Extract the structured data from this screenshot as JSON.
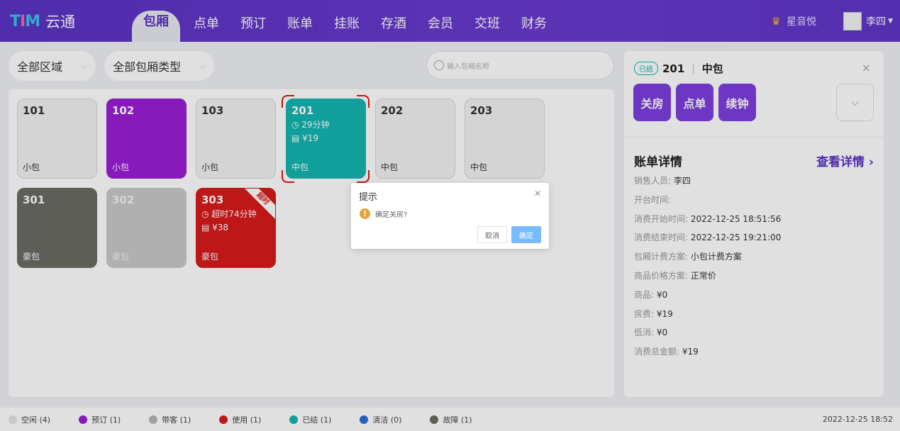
{
  "header": {
    "logo_letters": [
      "T",
      "I",
      "M"
    ],
    "logo_text": "云通",
    "nav": [
      "包厢",
      "点单",
      "预订",
      "账单",
      "挂账",
      "存酒",
      "会员",
      "交班",
      "财务"
    ],
    "active_nav": "包厢",
    "store_name": "星音悦",
    "user_name": "李四"
  },
  "filters": {
    "area": "全部区域",
    "room_type": "全部包厢类型",
    "search_placeholder": "输入包厢名称"
  },
  "rooms": [
    {
      "num": "101",
      "type": "小包",
      "state": "free"
    },
    {
      "num": "102",
      "type": "小包",
      "state": "reserved"
    },
    {
      "num": "103",
      "type": "小包",
      "state": "free"
    },
    {
      "num": "201",
      "type": "中包",
      "state": "settled",
      "duration": "29分钟",
      "amount": "¥19"
    },
    {
      "num": "202",
      "type": "中包",
      "state": "free"
    },
    {
      "num": "203",
      "type": "中包",
      "state": "free"
    },
    {
      "num": "301",
      "type": "豪包",
      "state": "fault"
    },
    {
      "num": "302",
      "type": "豪包",
      "state": "guest"
    },
    {
      "num": "303",
      "type": "豪包",
      "state": "inuse",
      "duration": "超时74分钟",
      "amount": "¥38",
      "ribbon": "超时"
    }
  ],
  "panel": {
    "status_badge": "已结",
    "room_num": "201",
    "room_type": "中包",
    "actions": [
      "关房",
      "点单",
      "续钟"
    ],
    "bill_title": "账单详情",
    "bill_link": "查看详情 ›",
    "bill_rows": [
      {
        "label": "销售人员:",
        "value": "李四"
      },
      {
        "label": "开台时间:",
        "value": ""
      },
      {
        "label": "消费开始时间:",
        "value": "2022-12-25 18:51:56"
      },
      {
        "label": "消费结束时间:",
        "value": "2022-12-25 19:21:00"
      },
      {
        "label": "包厢计费方案:",
        "value": "小包计费方案"
      },
      {
        "label": "商品价格方案:",
        "value": "正常价"
      },
      {
        "label": "商品:",
        "value": "¥0"
      },
      {
        "label": "房费:",
        "value": "¥19"
      },
      {
        "label": "低消:",
        "value": "¥0"
      },
      {
        "label": "消费总金额:",
        "value": "¥19"
      }
    ]
  },
  "statusbar": {
    "legend": [
      {
        "label": "空闲 (4)",
        "color": "#e3e3e3"
      },
      {
        "label": "预订 (1)",
        "color": "#9b1ed6"
      },
      {
        "label": "带客 (1)",
        "color": "#b5b5b5"
      },
      {
        "label": "使用 (1)",
        "color": "#d81b1b"
      },
      {
        "label": "已结 (1)",
        "color": "#13b5b1"
      },
      {
        "label": "清洁 (0)",
        "color": "#2b6fd6"
      },
      {
        "label": "故障 (1)",
        "color": "#6b6b66"
      }
    ],
    "datetime": "2022-12-25 18:52"
  },
  "dialog": {
    "title": "提示",
    "message": "确定关房?",
    "cancel": "取消",
    "confirm": "确定"
  }
}
